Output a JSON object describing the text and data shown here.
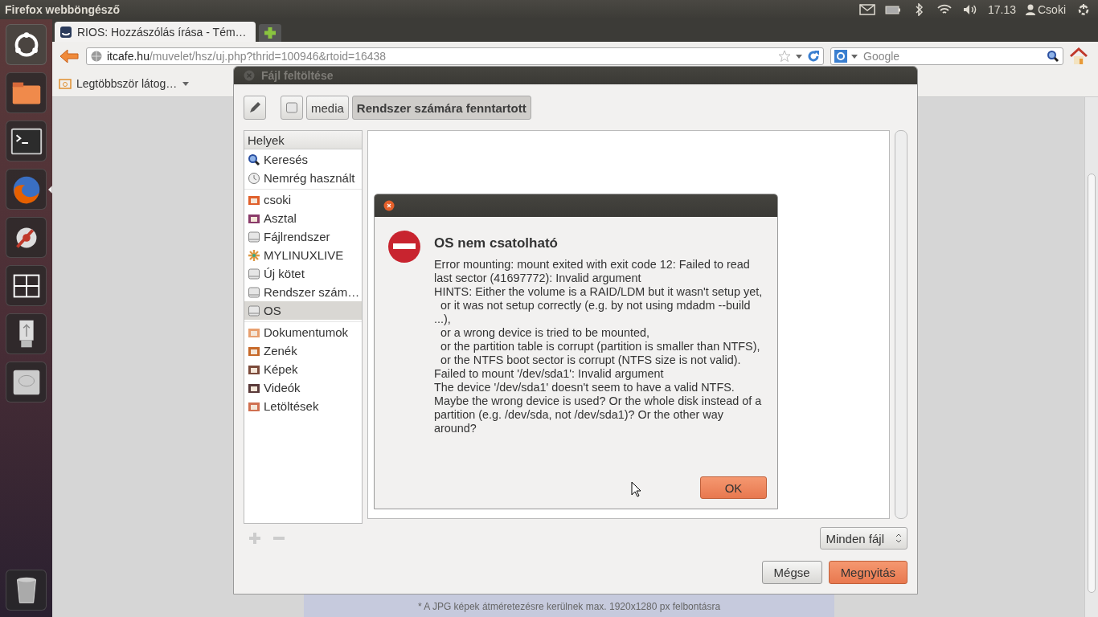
{
  "top_panel": {
    "app_title": "Firefox webböngésző",
    "clock": "17.13",
    "user": "Csoki"
  },
  "launcher": [
    {
      "kind": "dash",
      "active": false
    },
    {
      "kind": "files",
      "active": false
    },
    {
      "kind": "terminal",
      "active": false
    },
    {
      "kind": "firefox",
      "active": true
    },
    {
      "kind": "settings",
      "active": false
    },
    {
      "kind": "workspaces",
      "active": false
    },
    {
      "kind": "usb",
      "active": false
    },
    {
      "kind": "disk",
      "active": false
    },
    {
      "kind": "trash",
      "active": false
    }
  ],
  "browser": {
    "tab_title": "RIOS: Hozzászólás írása - Tém…",
    "url_host": "itcafe.hu",
    "url_path": "/muvelet/hsz/uj.php?thrid=100946&rtoid=16438",
    "search_placeholder": "Google",
    "bookmark": "Legtöbbször látog…",
    "page_note": "* A JPG képek átméretezésre kerülnek max. 1920x1280 px felbontásra"
  },
  "file_dialog": {
    "title": "Fájl feltöltése",
    "path_buttons": [
      {
        "label": "media",
        "selected": false
      },
      {
        "label": "Rendszer számára fenntartott",
        "selected": true
      }
    ],
    "places_header": "Helyek",
    "place_groups": [
      {
        "items": [
          {
            "label": "Keresés",
            "kind": "search",
            "selected": false
          },
          {
            "label": "Nemrég használt",
            "kind": "recent",
            "selected": false
          }
        ]
      },
      {
        "items": [
          {
            "label": "csoki",
            "kind": "home",
            "selected": false
          },
          {
            "label": "Asztal",
            "kind": "desktop",
            "selected": false
          },
          {
            "label": "Fájlrendszer",
            "kind": "drive",
            "selected": false
          },
          {
            "label": "MYLINUXLIVE",
            "kind": "flower",
            "selected": false
          },
          {
            "label": "Új kötet",
            "kind": "drive",
            "selected": false
          },
          {
            "label": "Rendszer szám…",
            "kind": "drive",
            "selected": false
          },
          {
            "label": "OS",
            "kind": "drive",
            "selected": true
          }
        ]
      },
      {
        "items": [
          {
            "label": "Dokumentumok",
            "kind": "documents",
            "selected": false
          },
          {
            "label": "Zenék",
            "kind": "music",
            "selected": false
          },
          {
            "label": "Képek",
            "kind": "pictures",
            "selected": false
          },
          {
            "label": "Videók",
            "kind": "videos",
            "selected": false
          },
          {
            "label": "Letöltések",
            "kind": "downloads",
            "selected": false
          }
        ]
      }
    ],
    "filter": "Minden fájl",
    "cancel": "Mégse",
    "open": "Megnyitás"
  },
  "error_dialog": {
    "title": "OS nem csatolható",
    "message": "Error mounting: mount exited with exit code 12: Failed to read last sector (41697772): Invalid argument\nHINTS: Either the volume is a RAID/LDM but it wasn't setup yet,\n  or it was not setup correctly (e.g. by not using mdadm --build ...),\n  or a wrong device is tried to be mounted,\n  or the partition table is corrupt (partition is smaller than NTFS),\n  or the NTFS boot sector is corrupt (NTFS size is not valid).\nFailed to mount '/dev/sda1': Invalid argument\nThe device '/dev/sda1' doesn't seem to have a valid NTFS.\nMaybe the wrong device is used? Or the whole disk instead of a partition (e.g. /dev/sda, not /dev/sda1)? Or the other way around?",
    "ok": "OK"
  }
}
